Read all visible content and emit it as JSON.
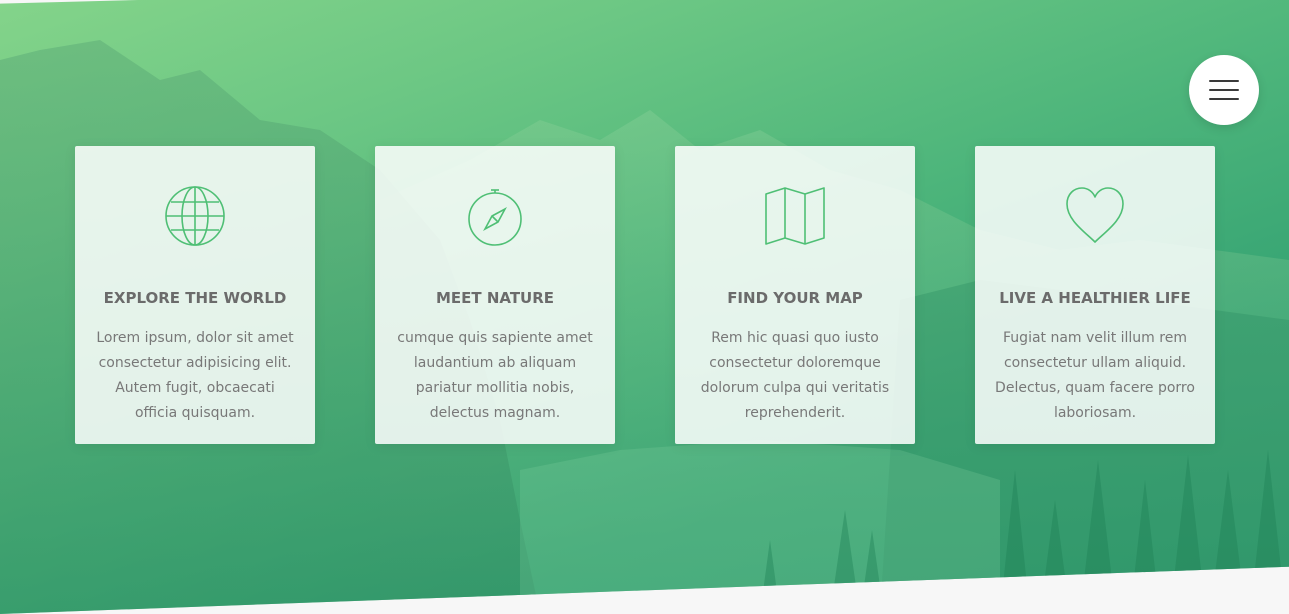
{
  "colors": {
    "accent_light": "#84d48a",
    "accent_dark": "#2b9a70",
    "icon_stroke": "#4fbf75",
    "card_bg": "#ffffff",
    "text_title": "#6b6b6b",
    "text_body": "#787878"
  },
  "menu": {
    "icon": "hamburger-menu-icon"
  },
  "cards": [
    {
      "icon": "globe-icon",
      "title": "EXPLORE THE WORLD",
      "text": "Lorem ipsum, dolor sit amet consectetur adipisicing elit. Autem fugit, obcaecati officia quisquam."
    },
    {
      "icon": "compass-icon",
      "title": "MEET NATURE",
      "text": "cumque quis sapiente amet laudantium ab aliquam pariatur mollitia nobis, delectus magnam."
    },
    {
      "icon": "map-icon",
      "title": "FIND YOUR MAP",
      "text": "Rem hic quasi quo iusto consectetur doloremque dolorum culpa qui veritatis reprehenderit."
    },
    {
      "icon": "heart-icon",
      "title": "LIVE A HEALTHIER LIFE",
      "text": "Fugiat nam velit illum rem consectetur ullam aliquid. Delectus, quam facere porro laboriosam."
    }
  ]
}
